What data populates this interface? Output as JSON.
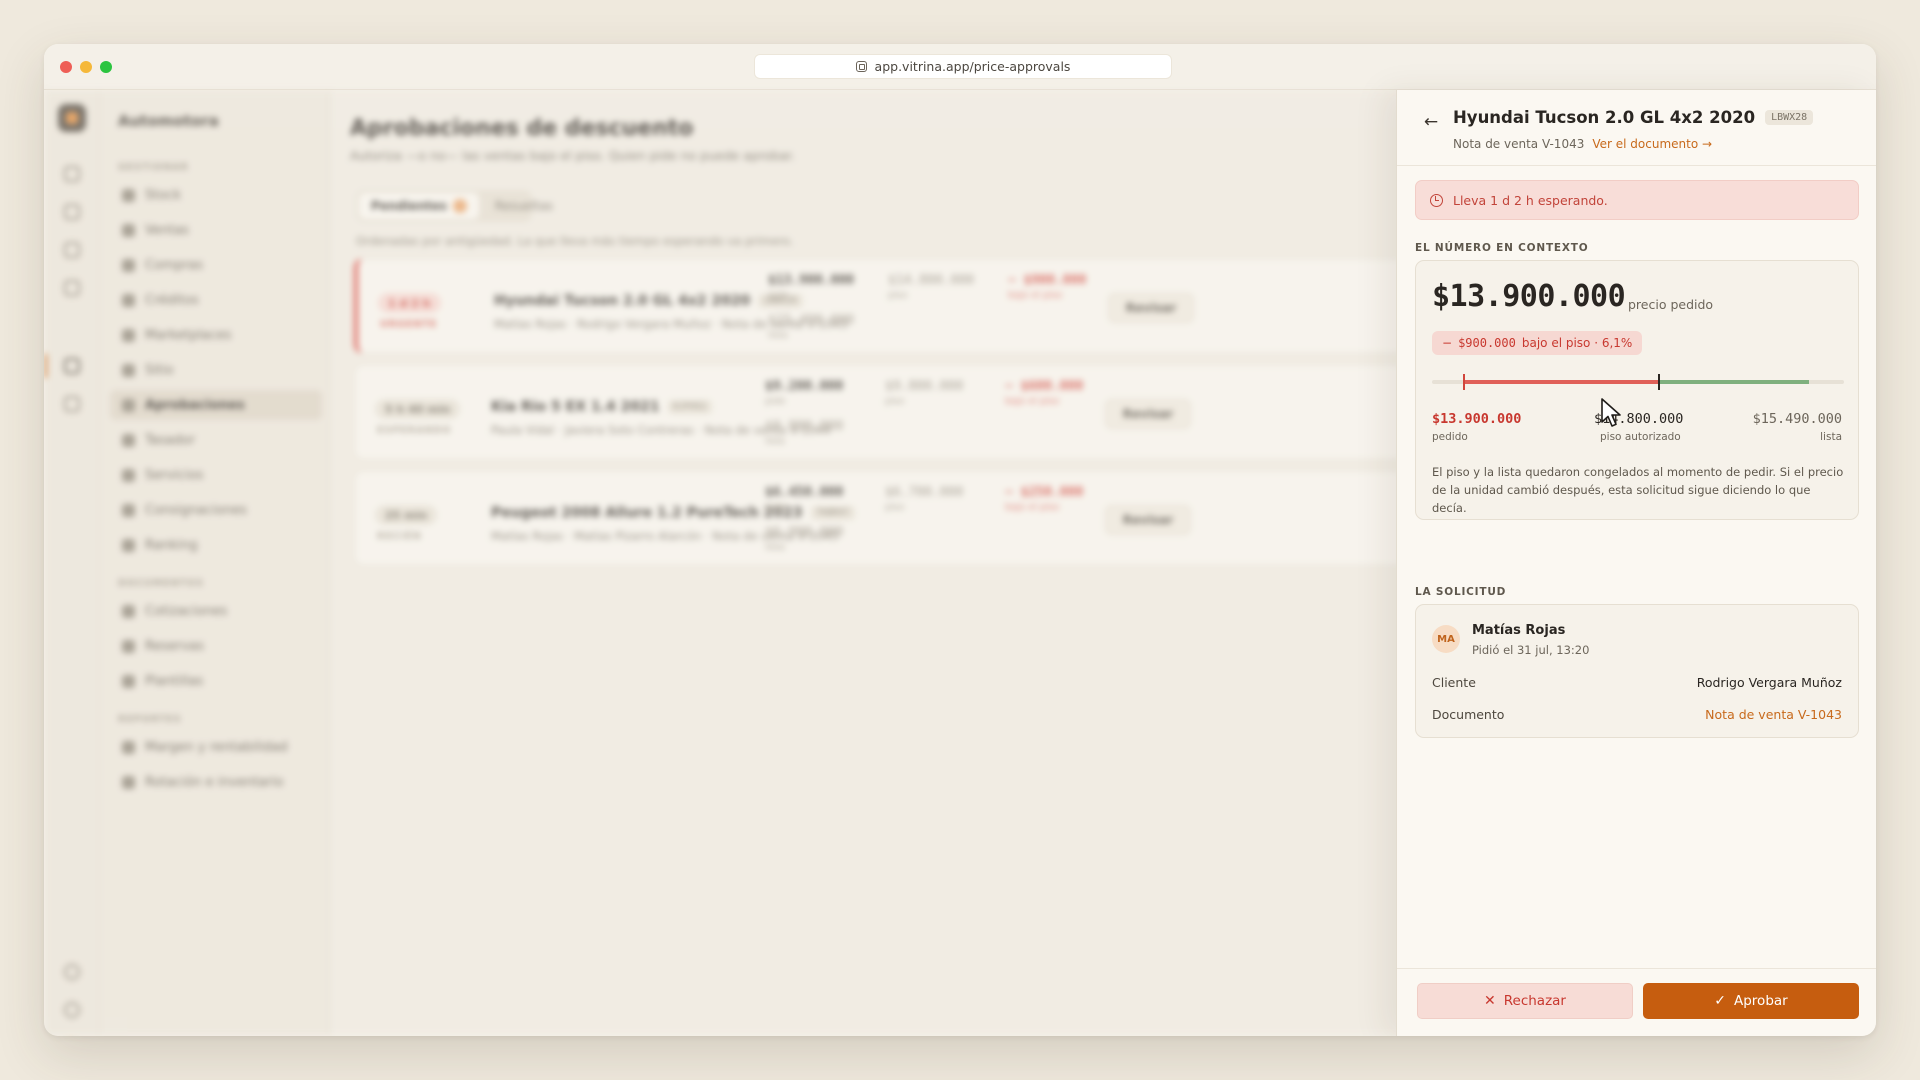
{
  "browser": {
    "url": "app.vitrina.app/price-approvals"
  },
  "colors": {
    "accent": "#c65d0f",
    "danger": "#c8382f",
    "success": "#7fb07e"
  },
  "background": {
    "brand": "Automotora",
    "sections": [
      "GESTIONAR",
      "DOCUMENTOS",
      "REPORTES"
    ],
    "nav_gestionar": [
      "Stock",
      "Ventas",
      "Compras",
      "Créditos",
      "Marketplaces",
      "Sitio",
      "Aprobaciones",
      "Tasador",
      "Servicios",
      "Consignaciones",
      "Ranking"
    ],
    "nav_documentos": [
      "Cotizaciones",
      "Reservas",
      "Plantillas"
    ],
    "nav_reportes": [
      "Margen y rentabilidad",
      "Rotación e inventario"
    ],
    "page_title": "Aprobaciones de descuento",
    "page_subtitle": "Autoriza —o no— las ventas bajo el piso. Quien pide no puede aprobar.",
    "tabs": {
      "pending": "Pendientes",
      "resolved": "Resueltas"
    },
    "hint": "Ordenadas por antigüedad. La que lleva más tiempo esperando va primero.",
    "review_label": "Revisar",
    "requests": [
      {
        "badge": "1 d 2 h",
        "status": "URGENTE",
        "vehicle": "Hyundai Tucson 2.0 GL 4x2 2020",
        "plate": "LBWX28",
        "meta": "Matías Rojas · Rodrigo Vergara Muñoz · Nota de venta V-1043",
        "ask": "$13.900.000",
        "ask_cap": "pide",
        "list": "$15.490.000",
        "list_cap": "lista",
        "floor": "$14.800.000",
        "floor_cap": "piso",
        "delta": "− $900.000",
        "delta_cap": "bajo el piso"
      },
      {
        "badge": "5 h 40 min",
        "status": "ESPERANDO",
        "vehicle": "Kia Rio 5 EX 1.4 2021",
        "plate": "KJFH52",
        "meta": "Paula Vidal · Javiera Soto Contreras · Nota de venta V-1044",
        "ask": "$9.200.000",
        "ask_cap": "pide",
        "list": "$9.990.000",
        "list_cap": "lista",
        "floor": "$9.800.000",
        "floor_cap": "piso",
        "delta": "− $600.000",
        "delta_cap": "bajo el piso"
      },
      {
        "badge": "25 min",
        "status": "RECIÉN",
        "vehicle": "Peugeot 2008 Allure 1.2 PureTech 2023",
        "plate": "TKBR97",
        "meta": "Matías Rojas · Matías Pizarro Alarcón · Nota de venta V-1045",
        "ask": "$6.450.000",
        "ask_cap": "pide",
        "list": "$6.990.000",
        "list_cap": "lista",
        "floor": "$6.700.000",
        "floor_cap": "piso",
        "delta": "− $250.000",
        "delta_cap": "bajo el piso"
      }
    ]
  },
  "panel": {
    "title": "Hyundai Tucson 2.0 GL 4x2 2020",
    "plate": "LBWX28",
    "doc": "Nota de venta V-1043",
    "doc_link": "Ver el documento →",
    "wait": "Lleva 1 d 2 h esperando.",
    "context_label": "EL NÚMERO EN CONTEXTO",
    "requested_price": "$13.900.000",
    "requested_cap": "precio pedido",
    "delta_prefix": "−",
    "delta_amount": "$900.000",
    "delta_text": "bajo el piso · 6,1%",
    "scale": {
      "min": 13900000,
      "floor": 14800000,
      "max": 15490000,
      "min_label": "$13.900.000",
      "min_cap": "pedido",
      "floor_label": "$14.800.000",
      "floor_cap": "piso autorizado",
      "max_label": "$15.490.000",
      "max_cap": "lista"
    },
    "note": "El piso y la lista quedaron congelados al momento de pedir. Si el precio de la unidad cambió después, esta solicitud sigue diciendo lo que decía.",
    "request_label": "LA SOLICITUD",
    "requester_initials": "MA",
    "requester_name": "Matías Rojas",
    "requested_when": "Pidió el 31 jul, 13:20",
    "client_key": "Cliente",
    "client_value": "Rodrigo Vergara Muñoz",
    "document_key": "Documento",
    "document_value": "Nota de venta V-1043",
    "reject_label": "Rechazar",
    "approve_label": "Aprobar"
  }
}
